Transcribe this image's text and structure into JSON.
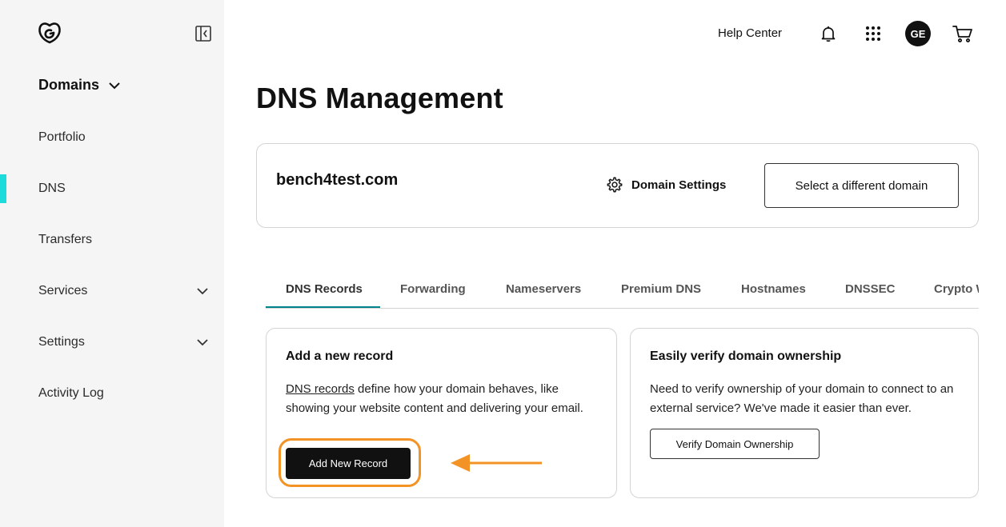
{
  "sidebar": {
    "logo_icon": "godaddy-logo-icon",
    "collapse_icon": "sidebar-collapse-icon",
    "section_title": "Domains",
    "items": [
      {
        "label": "Portfolio",
        "active": false,
        "has_chevron": false
      },
      {
        "label": "DNS",
        "active": true,
        "has_chevron": false
      },
      {
        "label": "Transfers",
        "active": false,
        "has_chevron": false
      },
      {
        "label": "Services",
        "active": false,
        "has_chevron": true
      },
      {
        "label": "Settings",
        "active": false,
        "has_chevron": true
      },
      {
        "label": "Activity Log",
        "active": false,
        "has_chevron": false
      }
    ],
    "active_accent": "#1bdbdb"
  },
  "header": {
    "help_label": "Help Center",
    "bell_icon": "bell-icon",
    "apps_icon": "apps-grid-icon",
    "avatar_initials": "GE",
    "cart_icon": "cart-icon"
  },
  "page": {
    "title": "DNS Management"
  },
  "domain_card": {
    "domain_name": "bench4test.com",
    "settings_label": "Domain Settings",
    "select_label": "Select a different domain"
  },
  "tabs": {
    "items": [
      "DNS Records",
      "Forwarding",
      "Nameservers",
      "Premium DNS",
      "Hostnames",
      "DNSSEC",
      "Crypto Wallet"
    ],
    "active_index": 0,
    "accent": "#00838c"
  },
  "add_record_card": {
    "title": "Add a new record",
    "link_text": "DNS records",
    "body_rest": " define how your domain behaves, like showing your website content and delivering your email.",
    "button_label": "Add New Record",
    "highlight_color": "#f39325"
  },
  "verify_card": {
    "title": "Easily verify domain ownership",
    "body": "Need to verify ownership of your domain to connect to an external service? We've made it easier than ever.",
    "button_label": "Verify Domain Ownership"
  }
}
